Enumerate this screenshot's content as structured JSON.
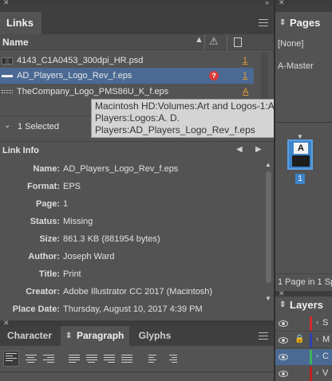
{
  "links_panel": {
    "tab_title": "Links",
    "column_name": "Name",
    "items": [
      {
        "name": "4143_C1A0453_300dpi_HR.psd",
        "page": "1",
        "status": ""
      },
      {
        "name": "AD_Players_Logo_Rev_f.eps",
        "page": "1",
        "status": "?"
      },
      {
        "name": "TheCompany_Logo_PMS86U_K_f.eps",
        "page": "A",
        "status": ""
      }
    ],
    "selected_count": "1 Selected",
    "tooltip_line1": "Macintosh HD:Volumes:Art and Logos-1:AD",
    "tooltip_line2": "Players:Logos:A. D.",
    "tooltip_line3": "Players:AD_Players_Logo_Rev_f.eps"
  },
  "link_info": {
    "title": "Link Info",
    "fields": [
      {
        "label": "Name:",
        "value": "AD_Players_Logo_Rev_f.eps"
      },
      {
        "label": "Format:",
        "value": "EPS"
      },
      {
        "label": "Page:",
        "value": "1"
      },
      {
        "label": "Status:",
        "value": "Missing"
      },
      {
        "label": "Size:",
        "value": "861.3 KB (881954 bytes)"
      },
      {
        "label": "Author:",
        "value": "Joseph Ward"
      },
      {
        "label": "Title:",
        "value": "Print"
      },
      {
        "label": "Creator:",
        "value": "Adobe Illustrator CC 2017 (Macintosh)"
      },
      {
        "label": "Place Date:",
        "value": "Thursday, August 10, 2017 4:39 PM"
      }
    ]
  },
  "bottom_tabs": {
    "character": "Character",
    "paragraph": "Paragraph",
    "glyphs": "Glyphs"
  },
  "pages_panel": {
    "tab_title": "Pages",
    "none": "[None]",
    "master": "A-Master",
    "thumb_letter": "A",
    "page_number": "1",
    "footer": "1 Page in 1 Sp"
  },
  "layers_panel": {
    "tab_title": "Layers",
    "layers": [
      {
        "initial": "S",
        "color": "#d22a2a"
      },
      {
        "initial": "M",
        "color": "#2f3fb0"
      },
      {
        "initial": "C",
        "color": "#3db35a"
      },
      {
        "initial": "V",
        "color": "#c21f1f"
      }
    ]
  },
  "colors": {
    "selection": "#4a6a94",
    "link_orange": "#e29a3a",
    "missing_red": "#d93a3a",
    "page_blue": "#3c83c9"
  }
}
